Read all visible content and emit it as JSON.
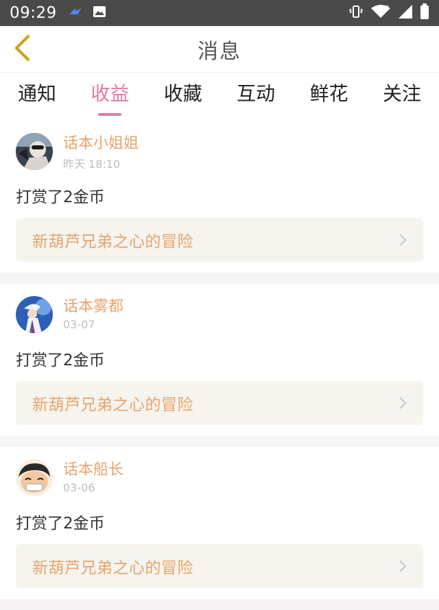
{
  "status_bar": {
    "time": "09:29",
    "left_icons": [
      "app-notification-icon",
      "image-notification-icon"
    ],
    "right_icons": [
      "vibrate-icon",
      "wifi-icon",
      "signal-icon",
      "battery-icon"
    ]
  },
  "header": {
    "title": "消息",
    "back_icon": "chevron-left-icon"
  },
  "tabs": [
    {
      "label": "通知",
      "active": false
    },
    {
      "label": "收益",
      "active": true
    },
    {
      "label": "收藏",
      "active": false
    },
    {
      "label": "互动",
      "active": false
    },
    {
      "label": "鲜花",
      "active": false
    },
    {
      "label": "关注",
      "active": false
    }
  ],
  "messages": [
    {
      "sender": "话本小姐姐",
      "time": "昨天 18:10",
      "text": "打赏了2金币",
      "book": "新葫芦兄弟之心的冒险"
    },
    {
      "sender": "话本雾都",
      "time": "03-07",
      "text": "打赏了2金币",
      "book": "新葫芦兄弟之心的冒险"
    },
    {
      "sender": "话本船长",
      "time": "03-06",
      "text": "打赏了2金币",
      "book": "新葫芦兄弟之心的冒险"
    }
  ],
  "colors": {
    "accent": "#e07aa3",
    "sender": "#e8a36b",
    "book_bg": "#f5f4ee",
    "back_arrow": "#e6c23a"
  }
}
